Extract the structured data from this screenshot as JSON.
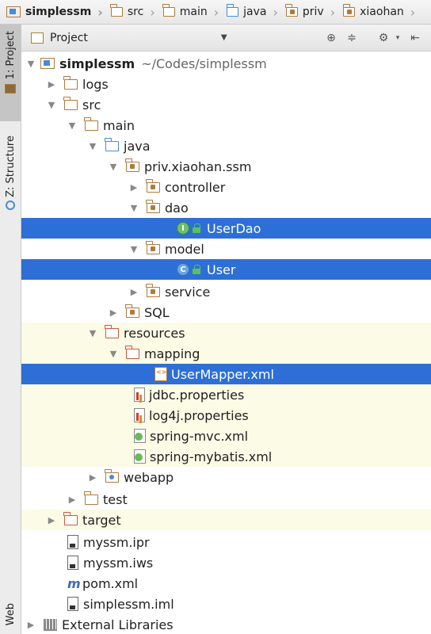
{
  "breadcrumb": [
    {
      "label": "simplessm",
      "icon": "module-folder-icon"
    },
    {
      "label": "src",
      "icon": "folder-icon"
    },
    {
      "label": "main",
      "icon": "folder-icon"
    },
    {
      "label": "java",
      "icon": "source-folder-icon"
    },
    {
      "label": "priv",
      "icon": "package-icon"
    },
    {
      "label": "xiaohan",
      "icon": "package-icon"
    }
  ],
  "sidebar": {
    "tab_project": "1: Project",
    "tab_structure": "Z: Structure",
    "tab_web": "Web"
  },
  "panel": {
    "title": "Project",
    "dropdown_icon": "chevron-down-icon"
  },
  "tree": {
    "root_name": "simplessm",
    "root_path": "~/Codes/simplessm",
    "logs": "logs",
    "src": "src",
    "main": "main",
    "java": "java",
    "package": "priv.xiaohan.ssm",
    "controller": "controller",
    "dao": "dao",
    "userdao": "UserDao",
    "model": "model",
    "user": "User",
    "service": "service",
    "sql": "SQL",
    "resources": "resources",
    "mapping": "mapping",
    "usermapper": "UserMapper.xml",
    "jdbc": "jdbc.properties",
    "log4j": "log4j.properties",
    "springmvc": "spring-mvc.xml",
    "springmybatis": "spring-mybatis.xml",
    "webapp": "webapp",
    "test": "test",
    "target": "target",
    "ipr": "myssm.ipr",
    "iws": "myssm.iws",
    "pom": "pom.xml",
    "iml": "simplessm.iml",
    "external": "External Libraries"
  },
  "colors": {
    "selection": "#2d6fd6",
    "resource_highlight": "#fbfbe6"
  }
}
